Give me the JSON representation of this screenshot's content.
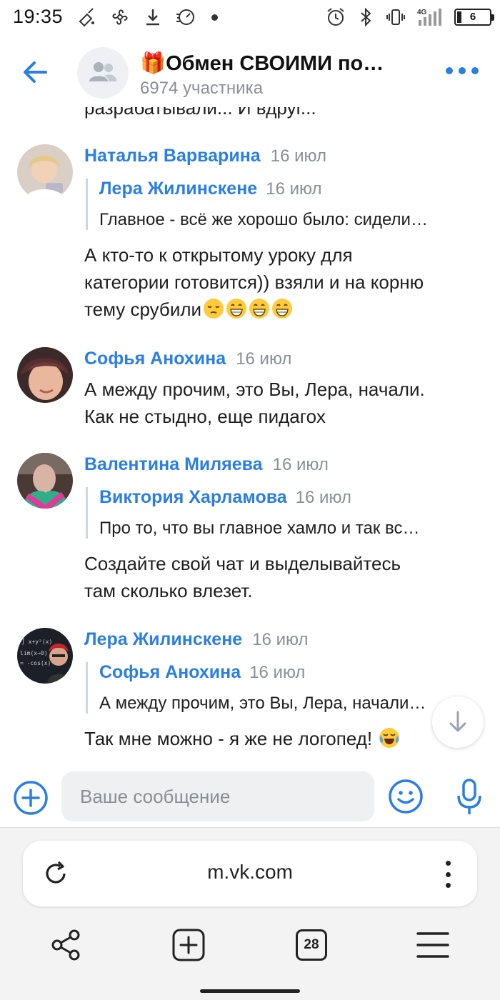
{
  "status_bar": {
    "time": "19:35",
    "network": "4G",
    "battery": "6",
    "icons_left": [
      "cleaner-icon",
      "pinwheel-icon",
      "download-icon",
      "speed-icon",
      "dot-icon"
    ],
    "icons_right": [
      "alarm-icon",
      "bluetooth-icon",
      "vibrate-icon",
      "signal-icon",
      "battery-icon"
    ]
  },
  "header": {
    "title": "🎁Обмен СВОИМИ по…",
    "subtitle": "6974 участника",
    "accent_color": "#2a7fe4"
  },
  "chat": {
    "cut_text": "разрабатывали... И вдруг...",
    "messages": [
      {
        "author": "Наталья Варварина",
        "date": "16 июл",
        "quote": {
          "author": "Лера Жилинскене",
          "date": "16 июл",
          "text": "Главное - всё же хорошо было: сидели…"
        },
        "lines": [
          "А кто-то к открытому уроку для",
          "категории готовится)) взяли и на корню",
          "тему срубили"
        ],
        "emojis": [
          "pensive",
          "grin",
          "grin",
          "grin"
        ]
      },
      {
        "author": "Софья Анохина",
        "date": "16 июл",
        "lines": [
          "А между прочим, это Вы, Лера, начали.",
          "Как не стыдно, еще пидагох"
        ]
      },
      {
        "author": "Валентина Миляева",
        "date": "16 июл",
        "quote": {
          "author": "Виктория Харламова",
          "date": "16 июл",
          "text": "Про то, что вы главное хамло и так вс…"
        },
        "lines": [
          "Создайте свой чат и выделывайтесь",
          "там сколько влезет."
        ]
      },
      {
        "author": "Лера Жилинскене",
        "date": "16 июл",
        "quote": {
          "author": "Софья Анохина",
          "date": "16 июл",
          "text": "А между прочим, это Вы, Лера, начали…"
        },
        "lines": [
          "Так мне можно - я же не логопед!"
        ],
        "emojis": [
          "tears-of-joy"
        ]
      }
    ]
  },
  "composer": {
    "placeholder": "Ваше сообщение"
  },
  "browser": {
    "url": "m.vk.com",
    "tabs_count": "28"
  }
}
